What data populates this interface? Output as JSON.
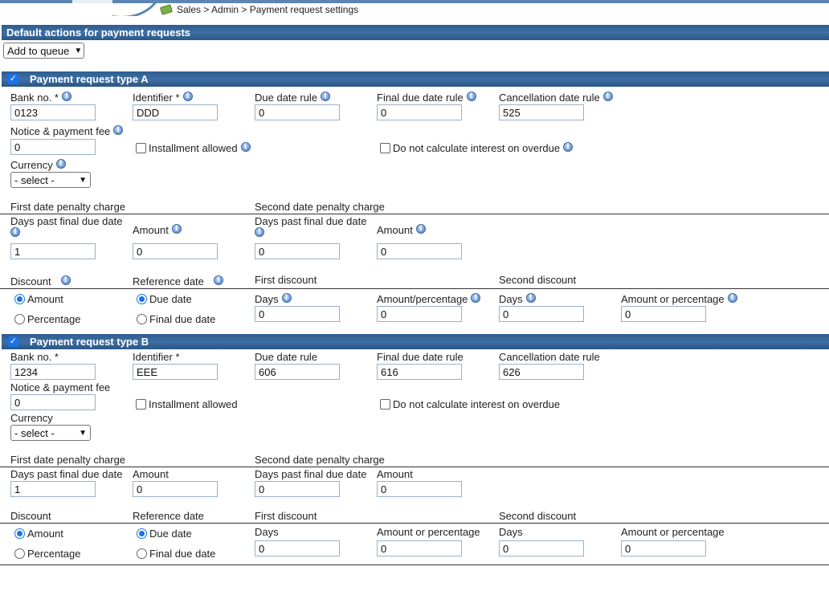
{
  "breadcrumb": "Sales > Admin > Payment request settings",
  "default_actions": {
    "title": "Default actions for payment requests",
    "selected": "Add to queue"
  },
  "labels": {
    "bank_no": "Bank no. *",
    "identifier": "Identifier *",
    "due_date_rule": "Due date rule",
    "final_due_date_rule": "Final due date rule",
    "cancellation_date_rule": "Cancellation date rule",
    "notice_fee": "Notice & payment fee",
    "installment_allowed": "Installment allowed",
    "no_interest": "Do not calculate interest on overdue",
    "currency": "Currency",
    "currency_placeholder": "- select -",
    "first_penalty": "First date penalty charge",
    "second_penalty": "Second date penalty charge",
    "days_past_final": "Days past final due date",
    "amount": "Amount",
    "discount": "Discount",
    "reference_date": "Reference date",
    "first_discount": "First discount",
    "second_discount": "Second discount",
    "radio_amount": "Amount",
    "radio_percentage": "Percentage",
    "radio_due_date": "Due date",
    "radio_final_due_date": "Final due date",
    "days": "Days",
    "amount_percentage_slash": "Amount/percentage",
    "amount_or_percentage": "Amount or percentage"
  },
  "type_a": {
    "title": "Payment request type A",
    "bank_no": "0123",
    "identifier": "DDD",
    "due_date_rule": "0",
    "final_due_date_rule": "0",
    "cancellation_date_rule": "525",
    "notice_fee": "0",
    "first_penalty_days": "1",
    "first_penalty_amount": "0",
    "second_penalty_days": "0",
    "second_penalty_amount": "0",
    "first_discount_days": "0",
    "first_discount_amount": "0",
    "second_discount_days": "0",
    "second_discount_amount": "0"
  },
  "type_b": {
    "title": "Payment request type B",
    "bank_no": "1234",
    "identifier": "EEE",
    "due_date_rule": "606",
    "final_due_date_rule": "616",
    "cancellation_date_rule": "626",
    "notice_fee": "0",
    "first_penalty_days": "1",
    "first_penalty_amount": "0",
    "second_penalty_days": "0",
    "second_penalty_amount": "0",
    "first_discount_days": "0",
    "first_discount_amount": "0",
    "second_discount_days": "0",
    "second_discount_amount": "0"
  },
  "colors": {
    "header_bar": "#3d6fa5",
    "checkbox_blue": "#1a73e8"
  },
  "icons": {
    "info": "info-icon",
    "breadcrumb": "money-icon",
    "check": "checkmark-icon"
  }
}
